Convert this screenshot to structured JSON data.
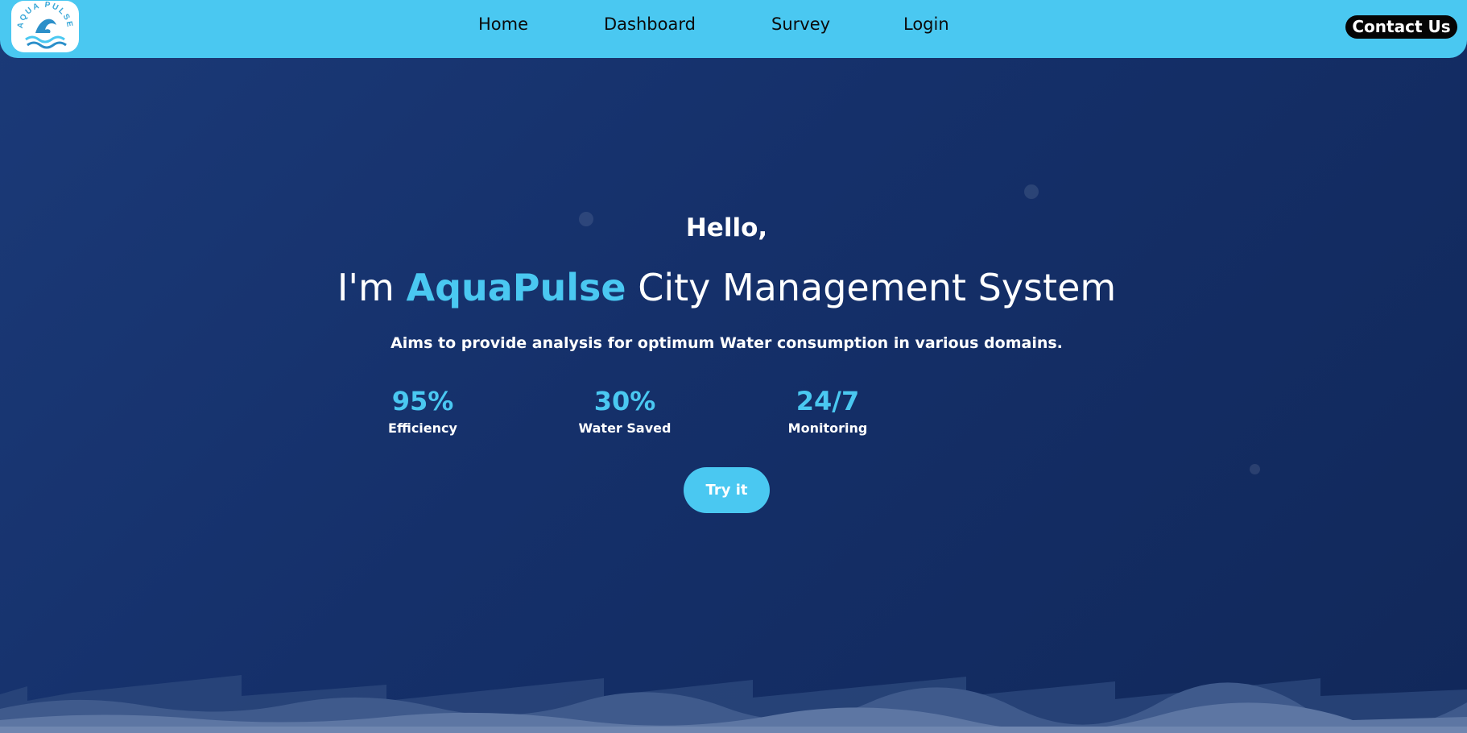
{
  "brand": {
    "logo_text": "AQUA PULSE",
    "logo_icon": "dolphin-wave-icon"
  },
  "nav": {
    "items": [
      {
        "label": "Home"
      },
      {
        "label": "Dashboard"
      },
      {
        "label": "Survey"
      },
      {
        "label": "Login"
      }
    ],
    "contact_label": "Contact Us"
  },
  "hero": {
    "greeting": "Hello,",
    "title_prefix": "I'm ",
    "title_accent": "AquaPulse",
    "title_suffix": " City Management System",
    "subtitle": "Aims to provide analysis for optimum Water consumption in various domains.",
    "stats": [
      {
        "value": "95%",
        "label": "Efficiency"
      },
      {
        "value": "30%",
        "label": "Water Saved"
      },
      {
        "value": "24/7",
        "label": "Monitoring"
      }
    ],
    "cta_label": "Try it"
  },
  "colors": {
    "accent": "#4ac8f1",
    "background": "#15306a",
    "contact_button": "#050505"
  }
}
